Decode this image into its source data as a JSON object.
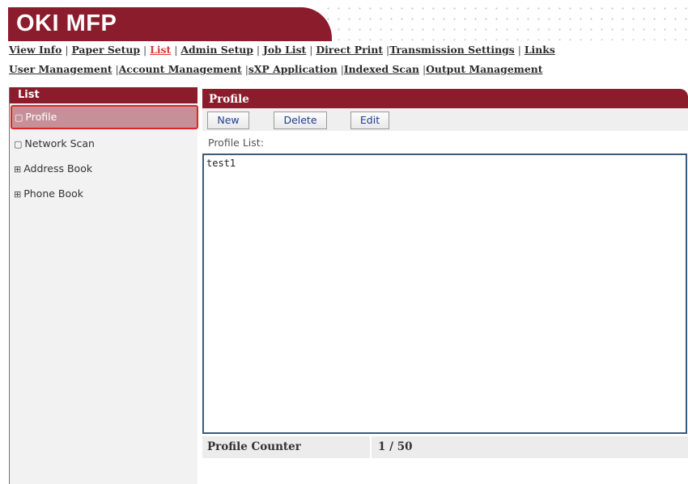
{
  "header": {
    "logo": "OKI MFP"
  },
  "nav": {
    "row1": [
      {
        "label": "View Info",
        "current": false
      },
      {
        "label": "Paper Setup",
        "current": false
      },
      {
        "label": "List",
        "current": true
      },
      {
        "label": "Admin Setup",
        "current": false
      },
      {
        "label": "Job List",
        "current": false
      },
      {
        "label": "Direct Print",
        "current": false
      },
      {
        "label": "Transmission Settings",
        "current": false
      },
      {
        "label": "Links",
        "current": false
      }
    ],
    "row2": [
      {
        "label": "User Management"
      },
      {
        "label": "Account Management"
      },
      {
        "label": "sXP Application"
      },
      {
        "label": "Indexed Scan"
      },
      {
        "label": "Output Management"
      }
    ]
  },
  "sidebar": {
    "title": "List",
    "items": [
      {
        "label": "Profile",
        "glyph": "▢",
        "icon": "collapse-box-icon",
        "active": true
      },
      {
        "label": "Network Scan",
        "glyph": "▢",
        "icon": "collapse-box-icon",
        "active": false
      },
      {
        "label": "Address Book",
        "glyph": "⊞",
        "icon": "expand-plus-icon",
        "active": false
      },
      {
        "label": "Phone Book",
        "glyph": "⊞",
        "icon": "expand-plus-icon",
        "active": false
      }
    ]
  },
  "panel": {
    "title": "Profile",
    "buttons": {
      "new": "New",
      "delete": "Delete",
      "edit": "Edit"
    },
    "list_label": "Profile List:",
    "list_items": [
      "test1"
    ],
    "counter_label": "Profile Counter",
    "counter_value": "1 / 50"
  },
  "colors": {
    "brand": "#8b1c2c",
    "active_link": "#d83a3a",
    "selected_item_bg": "#c79099",
    "selected_item_border": "#e0242a"
  }
}
